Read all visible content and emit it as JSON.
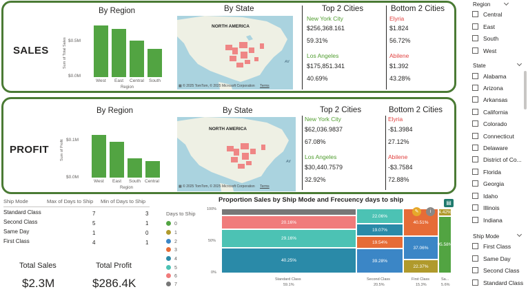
{
  "sales": {
    "title": "SALES",
    "by_region": {
      "title": "By Region",
      "ylabel": "Sum of Total Sales",
      "xlabel": "Region",
      "ticks": [
        "$0.5M",
        "$0.0M"
      ],
      "categories": [
        "West",
        "East",
        "Central",
        "South"
      ]
    },
    "by_state": {
      "title": "By State",
      "map_label": "NORTH AMERICA",
      "credit": "© 2025 TomTom, © 2025 Microsoft Corporation",
      "terms": "Terms",
      "ocean": "Atl"
    },
    "top2": {
      "title": "Top 2 Cities",
      "cities": [
        {
          "name": "New York City",
          "value": "$256,368.161",
          "pct": "59.31%"
        },
        {
          "name": "Los Angeles",
          "value": "$175,851.341",
          "pct": "40.69%"
        }
      ]
    },
    "bottom2": {
      "title": "Bottom 2 Cities",
      "cities": [
        {
          "name": "Elyria",
          "value": "$1.824",
          "pct": "56.72%"
        },
        {
          "name": "Abilene",
          "value": "$1.392",
          "pct": "43.28%"
        }
      ]
    }
  },
  "profit": {
    "title": "PROFIT",
    "by_region": {
      "title": "By Region",
      "ylabel": "Sum of Profit",
      "xlabel": "Region",
      "ticks": [
        "$0.1M",
        "$0.0M"
      ],
      "categories": [
        "West",
        "East",
        "South",
        "Central"
      ]
    },
    "by_state": {
      "title": "By State",
      "map_label": "NORTH AMERICA",
      "credit": "© 2025 TomTom, © 2025 Microsoft Corporation",
      "terms": "Terms",
      "ocean": "Atl"
    },
    "top2": {
      "title": "Top 2 Cities",
      "cities": [
        {
          "name": "New York City",
          "value": "$62,036.9837",
          "pct": "67.08%"
        },
        {
          "name": "Los Angeles",
          "value": "$30,440.7579",
          "pct": "32.92%"
        }
      ]
    },
    "bottom2": {
      "title": "Bottom 2 Cities",
      "cities": [
        {
          "name": "Elyria",
          "value": "-$1.3984",
          "pct": "27.12%"
        },
        {
          "name": "Abilene",
          "value": "-$3.7584",
          "pct": "72.88%"
        }
      ]
    }
  },
  "ship_table": {
    "headers": [
      "Ship Mode",
      "Max of Days to Ship",
      "Min of Days to Ship"
    ],
    "rows": [
      [
        "Standard Class",
        "7",
        "3"
      ],
      [
        "Second Class",
        "5",
        "1"
      ],
      [
        "Same Day",
        "1",
        "0"
      ],
      [
        "First Class",
        "4",
        "1"
      ]
    ]
  },
  "days_legend": {
    "title": "Days to Ship",
    "items": [
      {
        "label": "0",
        "color": "#52a442"
      },
      {
        "label": "1",
        "color": "#b09a2c"
      },
      {
        "label": "2",
        "color": "#3b86c6"
      },
      {
        "label": "3",
        "color": "#e66c37"
      },
      {
        "label": "4",
        "color": "#2a8aa8"
      },
      {
        "label": "5",
        "color": "#4cc2b4"
      },
      {
        "label": "6",
        "color": "#f07b7b"
      },
      {
        "label": "7",
        "color": "#777777"
      }
    ]
  },
  "cards": {
    "total_sales_label": "Total Sales",
    "total_sales_value": "$2.3M",
    "total_profit_label": "Total Profit",
    "total_profit_value": "$286.4K"
  },
  "proportion_chart": {
    "title": "Proportion Sales by Ship Mode and Frecuency days to ship",
    "yticks": [
      "100%",
      "50%",
      "0%"
    ],
    "columns": [
      {
        "name": "Standard Class",
        "share": "59.1%"
      },
      {
        "name": "Second Class",
        "share": "20.5%"
      },
      {
        "name": "First Class",
        "share": "15.3%"
      },
      {
        "name": "Sa...",
        "share": "5.6%"
      }
    ],
    "segment_labels": {
      "std": [
        "20.16%",
        "29.16%",
        "40.25%"
      ],
      "sec": [
        "22.06%",
        "19.07%",
        "19.54%",
        "39.28%"
      ],
      "first": [
        "40.51%",
        "37.06%",
        "22.37%"
      ],
      "same": [
        "4.42%",
        "95.58%"
      ]
    }
  },
  "slicers": {
    "region": {
      "title": "Region",
      "items": [
        "Central",
        "East",
        "South",
        "West"
      ]
    },
    "state": {
      "title": "State",
      "items": [
        "Alabama",
        "Arizona",
        "Arkansas",
        "California",
        "Colorado",
        "Connecticut",
        "Delaware",
        "District of Co...",
        "Florida",
        "Georgia",
        "Idaho",
        "Illinois",
        "Indiana"
      ]
    },
    "ship_mode": {
      "title": "Ship Mode",
      "items": [
        "First Class",
        "Same Day",
        "Second Class",
        "Standard Class"
      ]
    }
  },
  "colors": {
    "accent_green": "#52a442",
    "border_green": "#4a7a34",
    "top_city": "#4f9c2e",
    "bottom_city": "#e0413f"
  }
}
